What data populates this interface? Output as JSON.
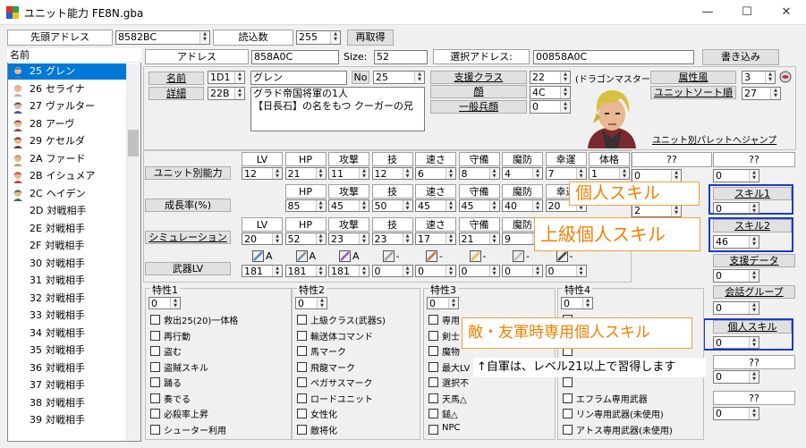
{
  "window": {
    "title": "ユニット能力 FE8N.gba",
    "minimize": "—",
    "maximize": "☐",
    "close": "✕"
  },
  "top": {
    "head_addr_label": "先頭アドレス",
    "head_addr_value": "8582BC",
    "read_count_label": "読込数",
    "read_count_value": "255",
    "reload_button": "再取得"
  },
  "list": {
    "header": "名前",
    "items": [
      {
        "id": "25",
        "name": "グレン"
      },
      {
        "id": "26",
        "name": "セライナ"
      },
      {
        "id": "27",
        "name": "ヴァルター"
      },
      {
        "id": "28",
        "name": "アーヴ"
      },
      {
        "id": "29",
        "name": "ケセルダ"
      },
      {
        "id": "2A",
        "name": "ファード"
      },
      {
        "id": "2B",
        "name": "イシュメア"
      },
      {
        "id": "2C",
        "name": "ヘイデン"
      },
      {
        "id": "2D",
        "name": "対戦相手"
      },
      {
        "id": "2E",
        "name": "対戦相手"
      },
      {
        "id": "2F",
        "name": "対戦相手"
      },
      {
        "id": "30",
        "name": "対戦相手"
      },
      {
        "id": "31",
        "name": "対戦相手"
      },
      {
        "id": "32",
        "name": "対戦相手"
      },
      {
        "id": "33",
        "name": "対戦相手"
      },
      {
        "id": "34",
        "name": "対戦相手"
      },
      {
        "id": "35",
        "name": "対戦相手"
      },
      {
        "id": "36",
        "name": "対戦相手"
      },
      {
        "id": "37",
        "name": "対戦相手"
      },
      {
        "id": "38",
        "name": "対戦相手"
      },
      {
        "id": "39",
        "name": "対戦相手"
      }
    ]
  },
  "info": {
    "address_label": "アドレス",
    "address_value": "858A0C",
    "size_label": "Size:",
    "size_value": "52",
    "sel_addr_label": "選択アドレス:",
    "sel_addr_value": "00858A0C",
    "write_button": "書き込み"
  },
  "unit": {
    "name_button": "名前",
    "name_id": "1D1",
    "name_value": "グレン",
    "no_label": "No",
    "no_value": "25",
    "detail_button": "詳細",
    "detail_id": "22B",
    "detail_text": "グラド帝国将軍の1人\n【日長石】の名をもつ クーガーの兄",
    "class_button": "支援クラス",
    "class_value": "22",
    "class_name": "(ドラゴンマスター)",
    "face_button": "顔",
    "face_value": "4C",
    "generic_button": "一般兵顔",
    "generic_value": "0",
    "attr_button": "属性風",
    "attr_value": "3",
    "sort_button": "ユニットソート順",
    "sort_value": "27",
    "palette_link": "ユニット別パレットへジャンプ"
  },
  "stats": {
    "cols1": [
      "LV",
      "HP",
      "攻撃",
      "技",
      "速さ",
      "守備",
      "魔防",
      "幸運",
      "体格"
    ],
    "row1_label": "ユニット別能力",
    "row1": [
      "12",
      "21",
      "11",
      "12",
      "6",
      "8",
      "4",
      "7",
      "1"
    ],
    "cols2": [
      "HP",
      "攻撃",
      "技",
      "速さ",
      "守備",
      "魔防",
      "幸運"
    ],
    "row2_label": "成長率(%)",
    "row2": [
      "85",
      "45",
      "50",
      "45",
      "45",
      "40",
      "20"
    ],
    "cols3": [
      "LV",
      "HP",
      "攻撃",
      "技",
      "速さ",
      "守備",
      "魔防"
    ],
    "row3_label": "シミュレーション",
    "row3": [
      "20",
      "52",
      "23",
      "23",
      "17",
      "21",
      "9"
    ],
    "weapon_label": "武器LV",
    "weapon_ranks": [
      "A",
      "A",
      "A",
      "-",
      "-",
      "-",
      "-",
      "-"
    ],
    "weapon_vals": [
      "181",
      "181",
      "181",
      "0",
      "0",
      "0",
      "0",
      "0"
    ],
    "unknown1_label": "??",
    "unknown1_value": "0",
    "unknown1b_value": "2"
  },
  "skills": {
    "personal_label": "個人スキル",
    "promoted_label": "上級個人スキル",
    "enemy_label": "敵・友軍時専用個人スキル",
    "note": "↑自軍は、レベル21以上で習得します",
    "skill1_button": "スキル1",
    "skill1_value": "0",
    "skill2_button": "スキル2",
    "skill2_value": "46",
    "support_button": "支援データ",
    "support_value": "0",
    "talk_button": "会話グループ",
    "talk_value": "0",
    "pskill_button": "個人スキル",
    "pskill_value": "0",
    "q1_label": "??",
    "q1_value": "0",
    "q2_label": "??",
    "q2_value": "0",
    "q0_label": "??",
    "q0_value": "0"
  },
  "traits": {
    "t1": {
      "title": "特性1",
      "value": "0",
      "items": [
        "救出25(20)一体格",
        "再行動",
        "盗む",
        "盗賊スキル",
        "踊る",
        "奏でる",
        "必殺率上昇",
        "シューター利用"
      ]
    },
    "t2": {
      "title": "特性2",
      "value": "0",
      "items": [
        "上級クラス(武器S)",
        "輸送体コマンド",
        "馬マーク",
        "飛龍マーク",
        "ペガサスマーク",
        "ロードユニット",
        "女性化",
        "敵将化"
      ]
    },
    "t3": {
      "title": "特性3",
      "value": "0",
      "items": [
        "専用",
        "剣士",
        "魔物",
        "最大LV",
        "選択不",
        "天馬△",
        "鎚△",
        "NPC"
      ]
    },
    "t4": {
      "title": "特性4",
      "value": "0",
      "items": [
        "",
        "",
        "",
        "",
        "",
        "エフラム専用武器",
        "リン専用武器(未使用)",
        "アトス専用武器(未使用)"
      ]
    }
  }
}
